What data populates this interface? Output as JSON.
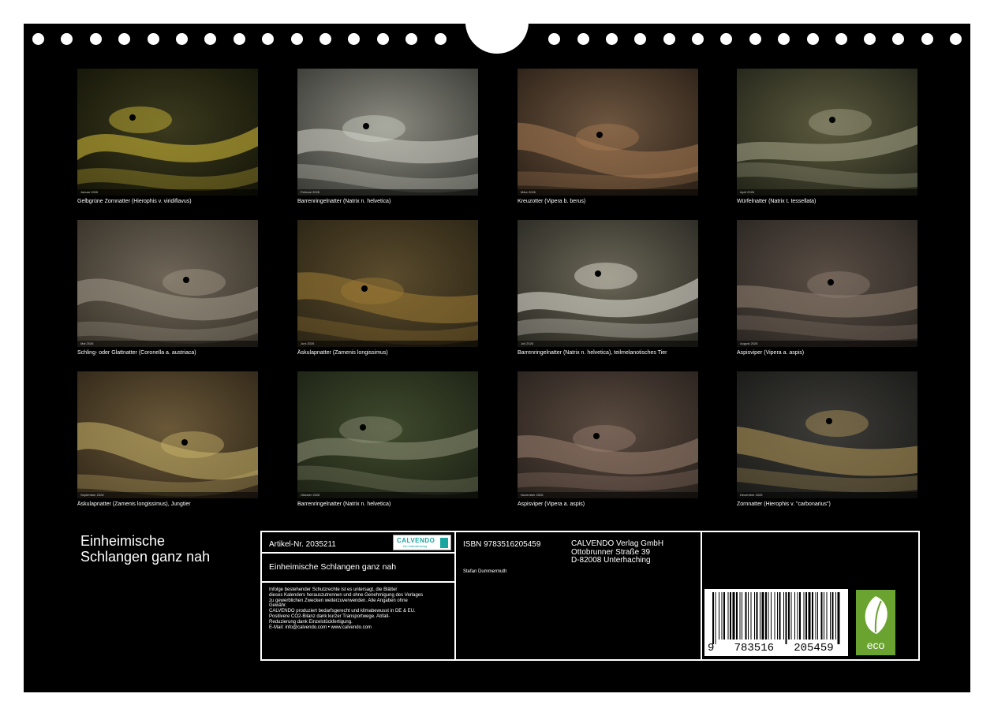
{
  "cover": {
    "title_line1": "Einheimische",
    "title_line2": "Schlangen ganz nah"
  },
  "photos": [
    {
      "month": "Januar 2026",
      "caption": "Gelbgrüne Zornnatter (Hierophis v. viridiflavus)"
    },
    {
      "month": "Februar 2026",
      "caption": "Barrenringelnatter (Natrix n. helvetica)"
    },
    {
      "month": "März 2026",
      "caption": "Kreuzotter (Vipera b. berus)"
    },
    {
      "month": "April 2026",
      "caption": "Würfelnatter (Natrix t. tessellata)"
    },
    {
      "month": "Mai 2026",
      "caption": "Schling- oder Glattnatter (Coronella a. austriaca)"
    },
    {
      "month": "Juni 2026",
      "caption": "Äskulapnatter (Zamenis longissimus)"
    },
    {
      "month": "Juli 2026",
      "caption": "Barrenringelnatter (Natrix n. helvetica), teilmelanotisches Tier"
    },
    {
      "month": "August 2026",
      "caption": "Aspisviper (Vipera a. aspis)"
    },
    {
      "month": "September 2026",
      "caption": "Äskulapnatter (Zamenis longissimus), Jungtier"
    },
    {
      "month": "Oktober 2026",
      "caption": "Barrenringelnatter (Natrix n. helvetica)"
    },
    {
      "month": "November 2026",
      "caption": "Aspisviper (Vipera a. aspis)"
    },
    {
      "month": "Dezember 2026",
      "caption": "Zornnatter (Hierophis v. \"carbonarius\")"
    }
  ],
  "info": {
    "article_number": "Artikel-Nr. 2035211",
    "brand_logo": "CALVENDO",
    "brand_tagline": "Der Kalenderverlag",
    "title": "Einheimische Schlangen ganz nah",
    "legal_lines": [
      "Infolge bestehender Schutzrechte ist es untersagt, die Blätter",
      "dieses Kalenders herauszutrennen und ohne Genehmigung des Verlages",
      "zu gewerblichen Zwecken weiterzuverwenden. Alle Angaben ohne",
      "Gewähr.",
      "CALVENDO produziert bedarfsgerecht und klimabewusst in DE & EU.",
      "Positivere CO2-Bilanz dank kurzer Transportwege. Abfall-",
      "Reduzierung dank Einzelstückfertigung.",
      "E-Mail: info@calvendo.com • www.calvendo.com"
    ],
    "isbn": "ISBN 9783516205459",
    "author": "Stefan Dummermuth",
    "publisher_lines": [
      "CALVENDO Verlag GmbH",
      "Ottobrunner Straße 39",
      "D-82008 Unterhaching"
    ],
    "barcode_digits": "9   783516   205459",
    "eco_label": "eco"
  },
  "colors": {
    "background": "#000000",
    "text": "#ffffff",
    "eco_green": "#6aa32f",
    "calvendo_teal": "#1aa5a0"
  }
}
